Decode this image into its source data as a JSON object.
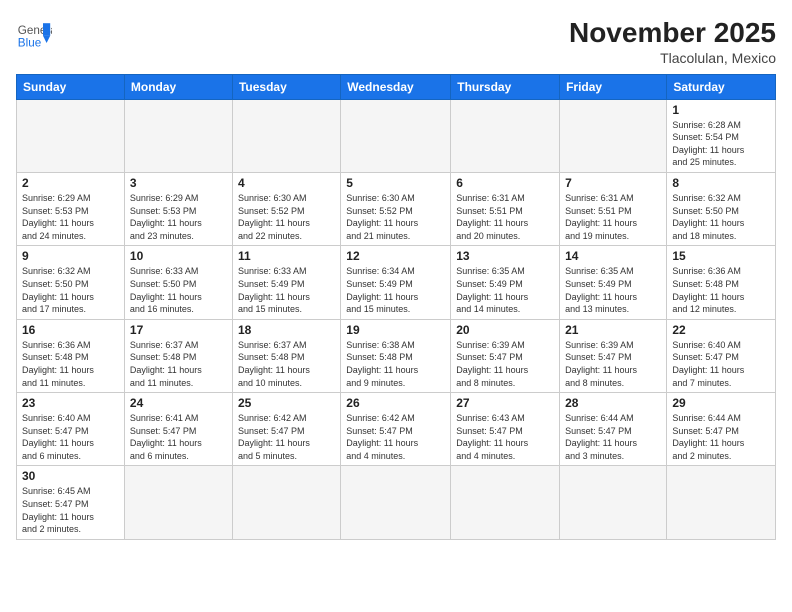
{
  "header": {
    "logo_general": "General",
    "logo_blue": "Blue",
    "month_title": "November 2025",
    "location": "Tlacolulan, Mexico"
  },
  "weekdays": [
    "Sunday",
    "Monday",
    "Tuesday",
    "Wednesday",
    "Thursday",
    "Friday",
    "Saturday"
  ],
  "weeks": [
    [
      {
        "day": "",
        "info": ""
      },
      {
        "day": "",
        "info": ""
      },
      {
        "day": "",
        "info": ""
      },
      {
        "day": "",
        "info": ""
      },
      {
        "day": "",
        "info": ""
      },
      {
        "day": "",
        "info": ""
      },
      {
        "day": "1",
        "info": "Sunrise: 6:28 AM\nSunset: 5:54 PM\nDaylight: 11 hours\nand 25 minutes."
      }
    ],
    [
      {
        "day": "2",
        "info": "Sunrise: 6:29 AM\nSunset: 5:53 PM\nDaylight: 11 hours\nand 24 minutes."
      },
      {
        "day": "3",
        "info": "Sunrise: 6:29 AM\nSunset: 5:53 PM\nDaylight: 11 hours\nand 23 minutes."
      },
      {
        "day": "4",
        "info": "Sunrise: 6:30 AM\nSunset: 5:52 PM\nDaylight: 11 hours\nand 22 minutes."
      },
      {
        "day": "5",
        "info": "Sunrise: 6:30 AM\nSunset: 5:52 PM\nDaylight: 11 hours\nand 21 minutes."
      },
      {
        "day": "6",
        "info": "Sunrise: 6:31 AM\nSunset: 5:51 PM\nDaylight: 11 hours\nand 20 minutes."
      },
      {
        "day": "7",
        "info": "Sunrise: 6:31 AM\nSunset: 5:51 PM\nDaylight: 11 hours\nand 19 minutes."
      },
      {
        "day": "8",
        "info": "Sunrise: 6:32 AM\nSunset: 5:50 PM\nDaylight: 11 hours\nand 18 minutes."
      }
    ],
    [
      {
        "day": "9",
        "info": "Sunrise: 6:32 AM\nSunset: 5:50 PM\nDaylight: 11 hours\nand 17 minutes."
      },
      {
        "day": "10",
        "info": "Sunrise: 6:33 AM\nSunset: 5:50 PM\nDaylight: 11 hours\nand 16 minutes."
      },
      {
        "day": "11",
        "info": "Sunrise: 6:33 AM\nSunset: 5:49 PM\nDaylight: 11 hours\nand 15 minutes."
      },
      {
        "day": "12",
        "info": "Sunrise: 6:34 AM\nSunset: 5:49 PM\nDaylight: 11 hours\nand 15 minutes."
      },
      {
        "day": "13",
        "info": "Sunrise: 6:35 AM\nSunset: 5:49 PM\nDaylight: 11 hours\nand 14 minutes."
      },
      {
        "day": "14",
        "info": "Sunrise: 6:35 AM\nSunset: 5:49 PM\nDaylight: 11 hours\nand 13 minutes."
      },
      {
        "day": "15",
        "info": "Sunrise: 6:36 AM\nSunset: 5:48 PM\nDaylight: 11 hours\nand 12 minutes."
      }
    ],
    [
      {
        "day": "16",
        "info": "Sunrise: 6:36 AM\nSunset: 5:48 PM\nDaylight: 11 hours\nand 11 minutes."
      },
      {
        "day": "17",
        "info": "Sunrise: 6:37 AM\nSunset: 5:48 PM\nDaylight: 11 hours\nand 11 minutes."
      },
      {
        "day": "18",
        "info": "Sunrise: 6:37 AM\nSunset: 5:48 PM\nDaylight: 11 hours\nand 10 minutes."
      },
      {
        "day": "19",
        "info": "Sunrise: 6:38 AM\nSunset: 5:48 PM\nDaylight: 11 hours\nand 9 minutes."
      },
      {
        "day": "20",
        "info": "Sunrise: 6:39 AM\nSunset: 5:47 PM\nDaylight: 11 hours\nand 8 minutes."
      },
      {
        "day": "21",
        "info": "Sunrise: 6:39 AM\nSunset: 5:47 PM\nDaylight: 11 hours\nand 8 minutes."
      },
      {
        "day": "22",
        "info": "Sunrise: 6:40 AM\nSunset: 5:47 PM\nDaylight: 11 hours\nand 7 minutes."
      }
    ],
    [
      {
        "day": "23",
        "info": "Sunrise: 6:40 AM\nSunset: 5:47 PM\nDaylight: 11 hours\nand 6 minutes."
      },
      {
        "day": "24",
        "info": "Sunrise: 6:41 AM\nSunset: 5:47 PM\nDaylight: 11 hours\nand 6 minutes."
      },
      {
        "day": "25",
        "info": "Sunrise: 6:42 AM\nSunset: 5:47 PM\nDaylight: 11 hours\nand 5 minutes."
      },
      {
        "day": "26",
        "info": "Sunrise: 6:42 AM\nSunset: 5:47 PM\nDaylight: 11 hours\nand 4 minutes."
      },
      {
        "day": "27",
        "info": "Sunrise: 6:43 AM\nSunset: 5:47 PM\nDaylight: 11 hours\nand 4 minutes."
      },
      {
        "day": "28",
        "info": "Sunrise: 6:44 AM\nSunset: 5:47 PM\nDaylight: 11 hours\nand 3 minutes."
      },
      {
        "day": "29",
        "info": "Sunrise: 6:44 AM\nSunset: 5:47 PM\nDaylight: 11 hours\nand 2 minutes."
      }
    ],
    [
      {
        "day": "30",
        "info": "Sunrise: 6:45 AM\nSunset: 5:47 PM\nDaylight: 11 hours\nand 2 minutes."
      },
      {
        "day": "",
        "info": ""
      },
      {
        "day": "",
        "info": ""
      },
      {
        "day": "",
        "info": ""
      },
      {
        "day": "",
        "info": ""
      },
      {
        "day": "",
        "info": ""
      },
      {
        "day": "",
        "info": ""
      }
    ]
  ]
}
